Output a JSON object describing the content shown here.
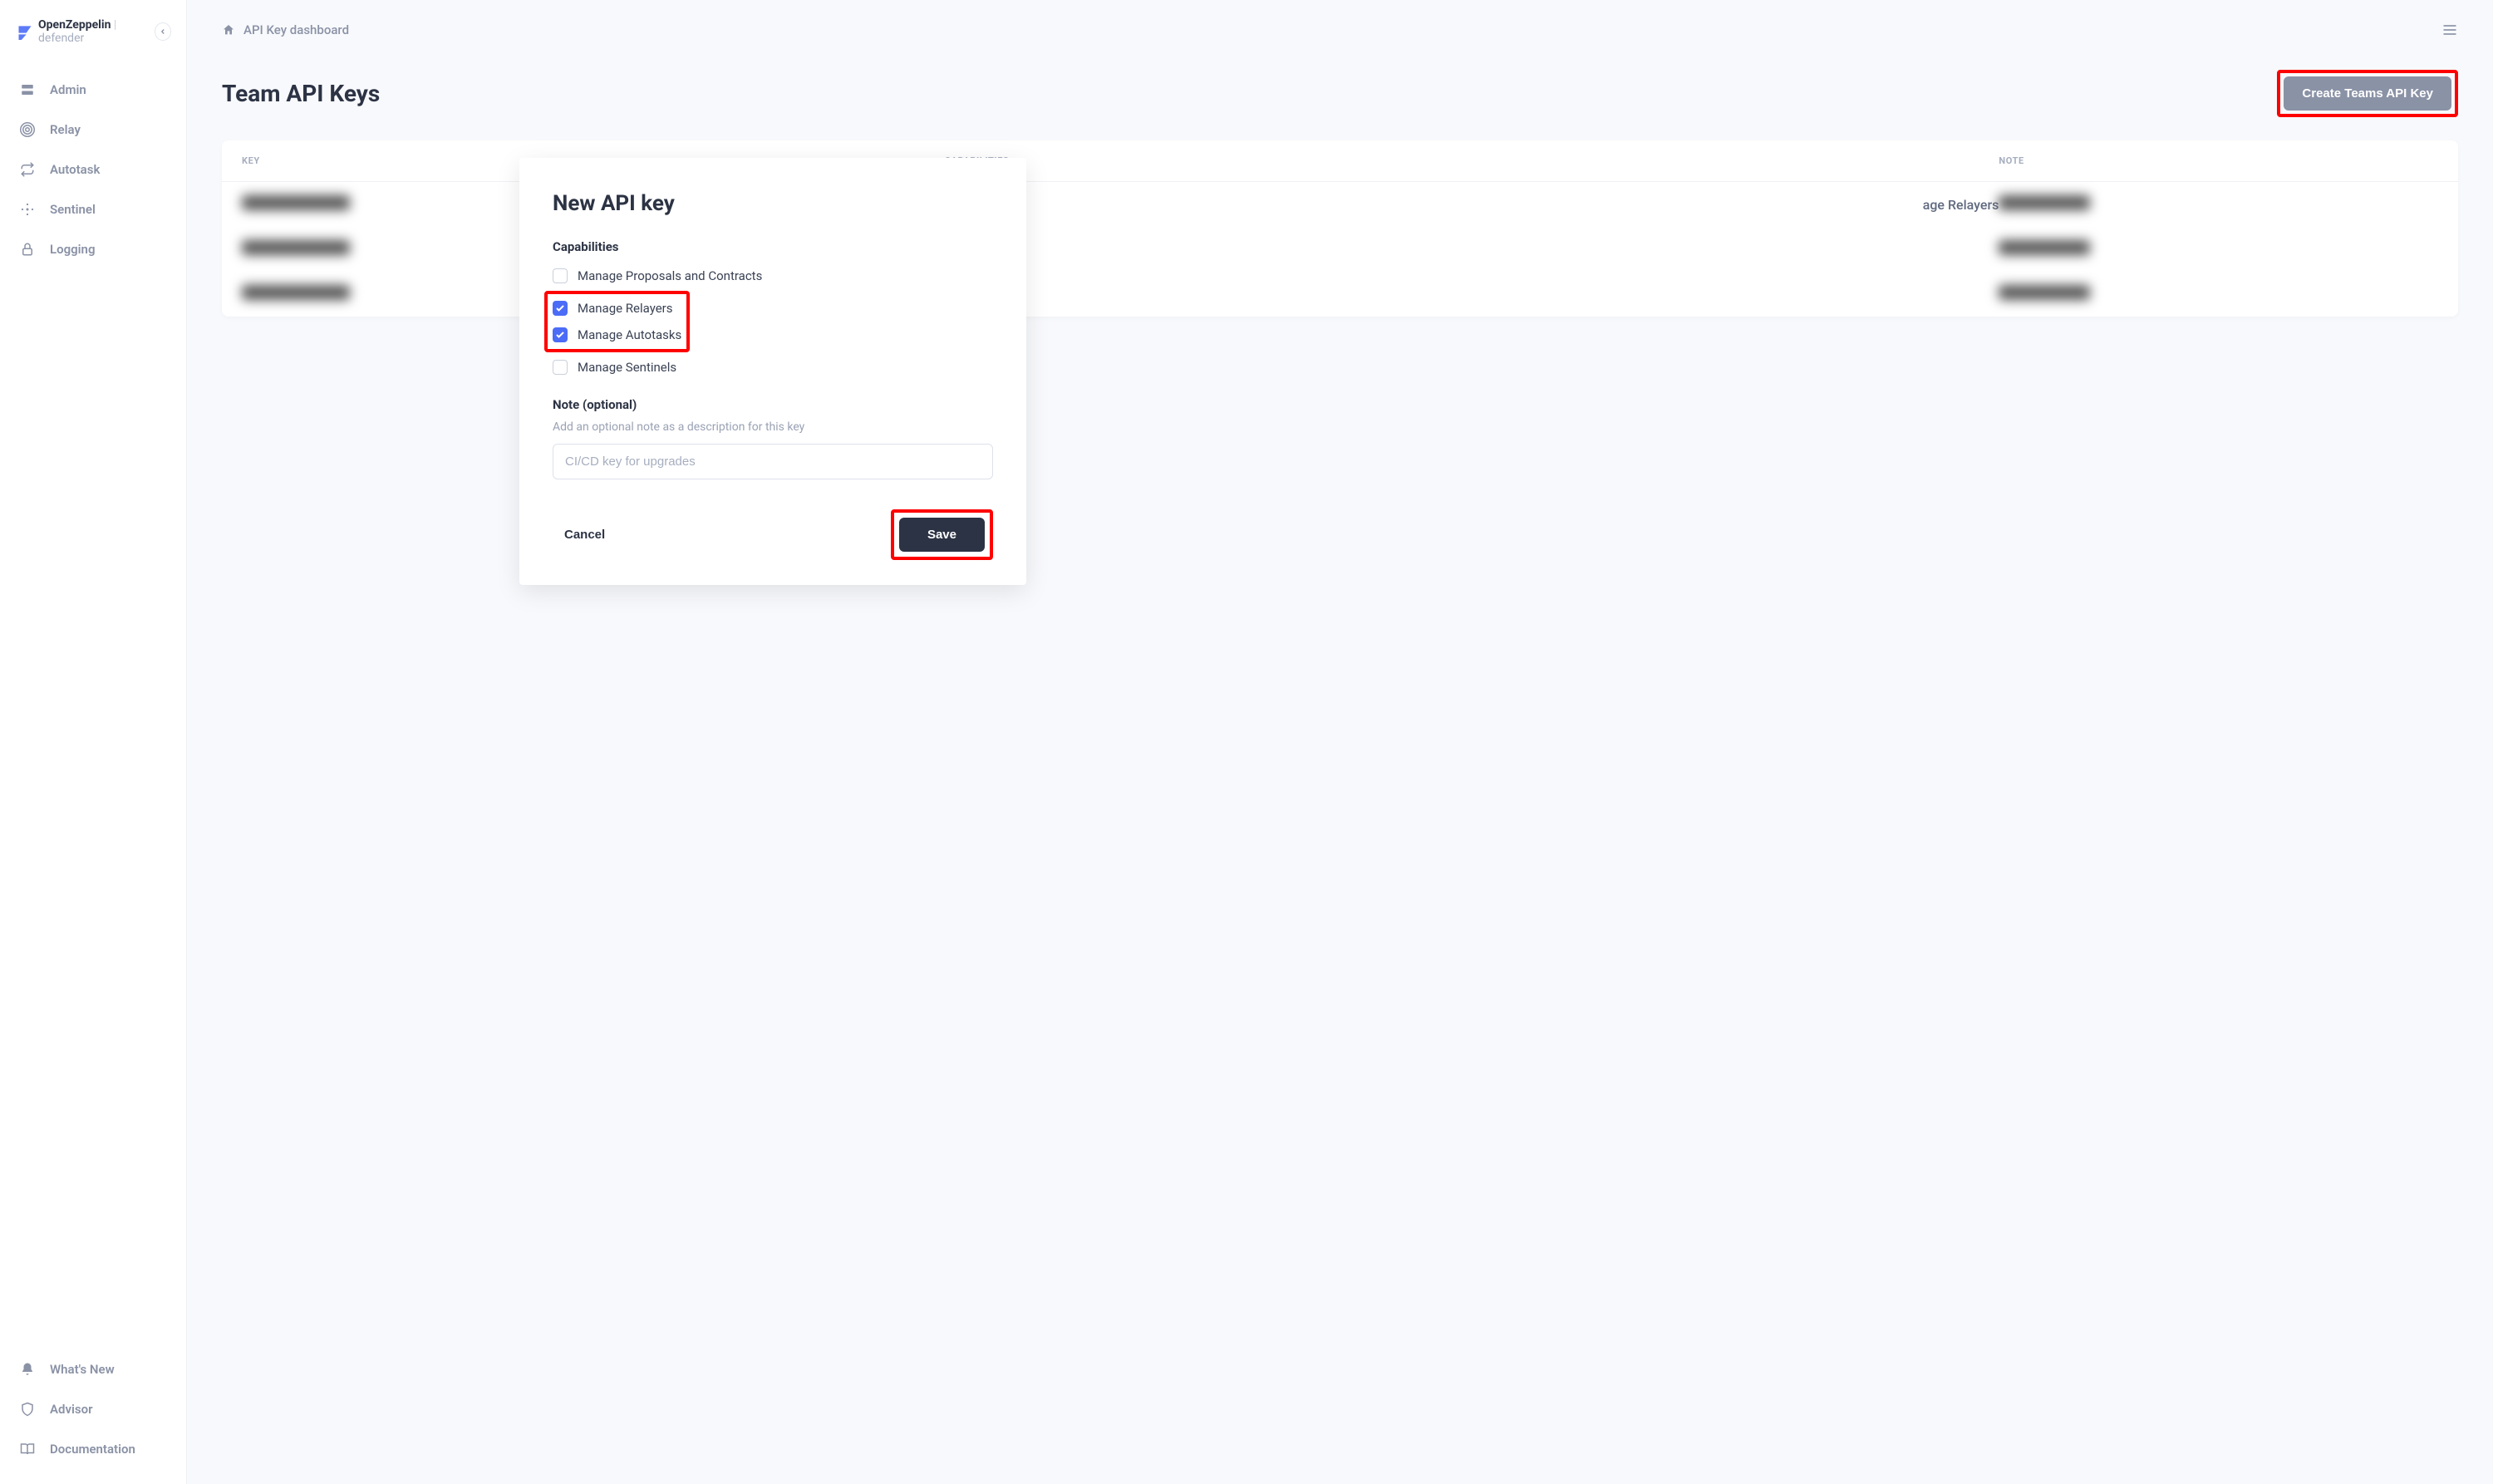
{
  "brand": {
    "name": "OpenZeppelin",
    "product": "defender"
  },
  "sidebar": {
    "items": [
      {
        "label": "Admin"
      },
      {
        "label": "Relay"
      },
      {
        "label": "Autotask"
      },
      {
        "label": "Sentinel"
      },
      {
        "label": "Logging"
      }
    ],
    "bottom": [
      {
        "label": "What's New"
      },
      {
        "label": "Advisor"
      },
      {
        "label": "Documentation"
      }
    ]
  },
  "breadcrumb": {
    "page": "API Key dashboard"
  },
  "page": {
    "title": "Team API Keys",
    "create_btn": "Create Teams API Key"
  },
  "table": {
    "headers": {
      "key": "KEY",
      "cap": "CAPABILITIES",
      "note": "NOTE"
    },
    "rows": [
      {
        "cap_visible": "age Relayers"
      },
      {
        "cap_visible": ""
      },
      {
        "cap_visible": ""
      }
    ]
  },
  "modal": {
    "title": "New API key",
    "cap_label": "Capabilities",
    "caps": [
      {
        "label": "Manage Proposals and Contracts",
        "checked": false
      },
      {
        "label": "Manage Relayers",
        "checked": true
      },
      {
        "label": "Manage Autotasks",
        "checked": true
      },
      {
        "label": "Manage Sentinels",
        "checked": false
      }
    ],
    "note_label": "Note (optional)",
    "note_hint": "Add an optional note as a description for this key",
    "note_placeholder": "CI/CD key for upgrades",
    "cancel": "Cancel",
    "save": "Save"
  }
}
